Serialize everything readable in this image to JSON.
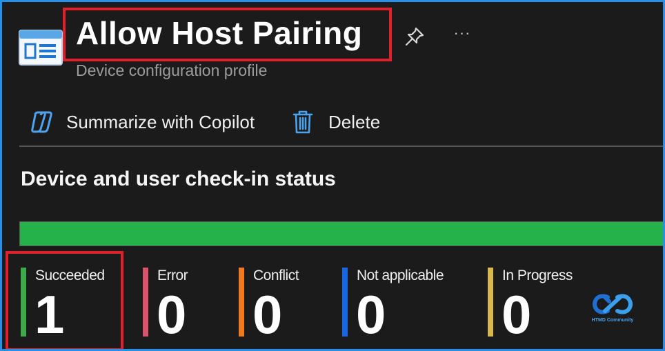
{
  "header": {
    "title": "Allow Host Pairing",
    "subtitle": "Device configuration profile",
    "more_label": "···"
  },
  "toolbar": {
    "copilot_label": "Summarize with Copilot",
    "delete_label": "Delete"
  },
  "section": {
    "title": "Device and user check-in status"
  },
  "status_bar": {
    "succeeded_fraction": 1.0,
    "fill_color": "#25b24a"
  },
  "stats": [
    {
      "label": "Succeeded",
      "count": "1",
      "color": "#3ea84a"
    },
    {
      "label": "Error",
      "count": "0",
      "color": "#d9536a"
    },
    {
      "label": "Conflict",
      "count": "0",
      "color": "#f07a1f"
    },
    {
      "label": "Not applicable",
      "count": "0",
      "color": "#1967e0"
    },
    {
      "label": "In Progress",
      "count": "0",
      "color": "#d8b84a"
    }
  ],
  "watermark": {
    "text": "HTMD Community"
  },
  "colors": {
    "accent": "#2a8fe6",
    "highlight": "#e0212b",
    "background": "#1b1b1b"
  }
}
